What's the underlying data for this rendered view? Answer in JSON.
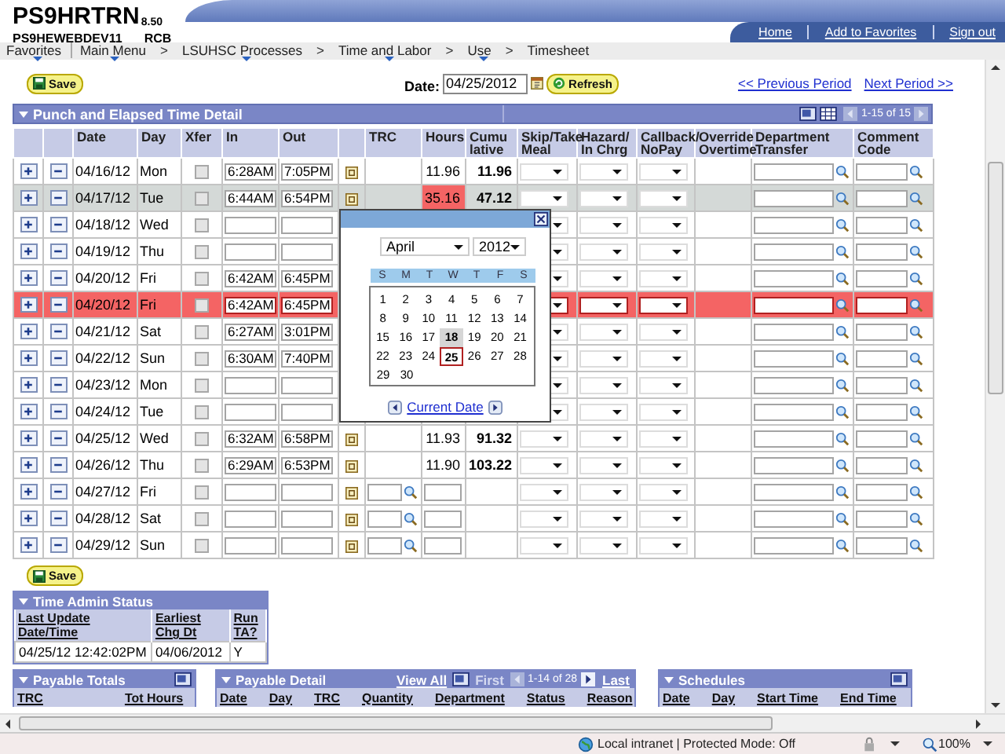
{
  "header": {
    "app_name": "PS9HRTRN",
    "version": "8.50",
    "server": "PS9HEWEBDEV11",
    "user": "RCB",
    "links": [
      "Home",
      "Add to Favorites",
      "Sign out"
    ]
  },
  "breadcrumb": [
    {
      "text": "Favorites",
      "menu": true,
      "divider": false
    },
    {
      "text": "Main Menu",
      "menu": true,
      "divider": true
    },
    {
      "text": "LSUHSC Processes",
      "menu": true,
      "divider": false,
      "arrow": ">"
    },
    {
      "text": "Time and Labor",
      "menu": true,
      "divider": false,
      "arrow": ">"
    },
    {
      "text": "Use",
      "menu": true,
      "divider": false,
      "arrow": ">"
    },
    {
      "text": "Timesheet",
      "menu": false,
      "divider": false,
      "arrow": ">"
    }
  ],
  "toolbar": {
    "save": "Save",
    "date_label": "Date:",
    "date": "04/25/2012",
    "refresh": "Refresh",
    "prev": "<< Previous Period",
    "next": "Next Period >>"
  },
  "grid": {
    "title": "Punch and Elapsed Time Detail",
    "counter": "1-15 of 15",
    "columns": [
      "Date",
      "Day",
      "Xfer",
      "In",
      "Out",
      "TRC",
      "Hours",
      "Cumu lative",
      "Skip/Take Meal",
      "Hazard/ In Chrg",
      "Callback/ NoPay",
      "Override Overtime",
      "Department Transfer",
      "Comment Code"
    ],
    "rows": [
      {
        "kind": "punch",
        "selected": false,
        "error": false,
        "date": "04/16/12",
        "day": "Mon",
        "xfer": false,
        "in": "6:28AM",
        "out": "7:05PM",
        "hours": "11.96",
        "hours_error": false,
        "cumulative": "11.96"
      },
      {
        "kind": "punch",
        "selected": true,
        "error": false,
        "date": "04/17/12",
        "day": "Tue",
        "xfer": false,
        "in": "6:44AM",
        "out": "6:54PM",
        "hours": "35.16",
        "hours_error": true,
        "cumulative": "47.12"
      },
      {
        "kind": "punch",
        "selected": false,
        "error": false,
        "date": "04/18/12",
        "day": "Wed",
        "xfer": false
      },
      {
        "kind": "punch",
        "selected": false,
        "error": false,
        "date": "04/19/12",
        "day": "Thu",
        "xfer": false
      },
      {
        "kind": "punch",
        "selected": false,
        "error": false,
        "date": "04/20/12",
        "day": "Fri",
        "xfer": false,
        "in": "6:42AM",
        "out": "6:45PM"
      },
      {
        "kind": "punch",
        "selected": false,
        "error": true,
        "date": "04/20/12",
        "day": "Fri",
        "xfer": false,
        "in": "6:42AM",
        "out": "6:45PM"
      },
      {
        "kind": "punch",
        "selected": false,
        "error": false,
        "date": "04/21/12",
        "day": "Sat",
        "xfer": false,
        "in": "6:27AM",
        "out": "3:01PM"
      },
      {
        "kind": "punch",
        "selected": false,
        "error": false,
        "date": "04/22/12",
        "day": "Sun",
        "xfer": false,
        "in": "6:30AM",
        "out": "7:40PM"
      },
      {
        "kind": "punch",
        "selected": false,
        "error": false,
        "date": "04/23/12",
        "day": "Mon",
        "xfer": false
      },
      {
        "kind": "punch",
        "selected": false,
        "error": false,
        "date": "04/24/12",
        "day": "Tue",
        "xfer": false
      },
      {
        "kind": "punch",
        "selected": false,
        "error": false,
        "date": "04/25/12",
        "day": "Wed",
        "xfer": false,
        "in": "6:32AM",
        "out": "6:58PM",
        "hours": "11.93",
        "hours_error": false,
        "cumulative": "91.32"
      },
      {
        "kind": "punch",
        "selected": false,
        "error": false,
        "date": "04/26/12",
        "day": "Thu",
        "xfer": false,
        "in": "6:29AM",
        "out": "6:53PM",
        "hours": "11.90",
        "hours_error": false,
        "cumulative": "103.22"
      },
      {
        "kind": "elapsed",
        "selected": false,
        "error": false,
        "date": "04/27/12",
        "day": "Fri",
        "xfer": false
      },
      {
        "kind": "elapsed",
        "selected": false,
        "error": false,
        "date": "04/28/12",
        "day": "Sat",
        "xfer": false
      },
      {
        "kind": "elapsed",
        "selected": false,
        "error": false,
        "date": "04/29/12",
        "day": "Sun",
        "xfer": false
      }
    ]
  },
  "calendar": {
    "month": "April",
    "year": "2012",
    "weekdays": [
      "S",
      "M",
      "T",
      "W",
      "T",
      "F",
      "S"
    ],
    "current_date": "Current Date",
    "weeks": [
      [
        {
          "day": "1",
          "today": false,
          "selected": false
        },
        {
          "day": "2",
          "today": false,
          "selected": false
        },
        {
          "day": "3",
          "today": false,
          "selected": false
        },
        {
          "day": "4",
          "today": false,
          "selected": false
        },
        {
          "day": "5",
          "today": false,
          "selected": false
        },
        {
          "day": "6",
          "today": false,
          "selected": false
        },
        {
          "day": "7",
          "today": false,
          "selected": false
        }
      ],
      [
        {
          "day": "8",
          "today": false,
          "selected": false
        },
        {
          "day": "9",
          "today": false,
          "selected": false
        },
        {
          "day": "10",
          "today": false,
          "selected": false
        },
        {
          "day": "11",
          "today": false,
          "selected": false
        },
        {
          "day": "12",
          "today": false,
          "selected": false
        },
        {
          "day": "13",
          "today": false,
          "selected": false
        },
        {
          "day": "14",
          "today": false,
          "selected": false
        }
      ],
      [
        {
          "day": "15",
          "today": false,
          "selected": false
        },
        {
          "day": "16",
          "today": false,
          "selected": false
        },
        {
          "day": "17",
          "today": false,
          "selected": false
        },
        {
          "day": "18",
          "today": true,
          "selected": false
        },
        {
          "day": "19",
          "today": false,
          "selected": false
        },
        {
          "day": "20",
          "today": false,
          "selected": false
        },
        {
          "day": "21",
          "today": false,
          "selected": false
        }
      ],
      [
        {
          "day": "22",
          "today": false,
          "selected": false
        },
        {
          "day": "23",
          "today": false,
          "selected": false
        },
        {
          "day": "24",
          "today": false,
          "selected": false
        },
        {
          "day": "25",
          "today": false,
          "selected": true
        },
        {
          "day": "26",
          "today": false,
          "selected": false
        },
        {
          "day": "27",
          "today": false,
          "selected": false
        },
        {
          "day": "28",
          "today": false,
          "selected": false
        }
      ],
      [
        {
          "day": "29",
          "today": false,
          "selected": false
        },
        {
          "day": "30",
          "today": false,
          "selected": false
        }
      ]
    ]
  },
  "bottom_save": "Save",
  "admin_status": {
    "title": "Time Admin Status",
    "columns": [
      "Last Update Date/Time",
      "Earliest Chg Dt",
      "Run TA?"
    ],
    "values": [
      "04/25/12 12:42:02PM",
      "04/06/2012",
      "Y"
    ]
  },
  "payable_totals": {
    "title": "Payable Totals",
    "columns": [
      "TRC",
      "Tot Hours"
    ]
  },
  "payable_detail": {
    "title": "Payable Detail",
    "view_all": "View All",
    "first": "First",
    "counter": "1-14 of 28",
    "last": "Last",
    "columns": [
      "Date",
      "Day",
      "TRC",
      "Quantity",
      "Department",
      "Status",
      "Reason"
    ]
  },
  "schedules": {
    "title": "Schedules",
    "columns": [
      "Date",
      "Day",
      "Start Time",
      "End Time"
    ]
  },
  "status_bar": {
    "zone": "Local intranet | Protected Mode: Off",
    "zoom": "100%"
  }
}
